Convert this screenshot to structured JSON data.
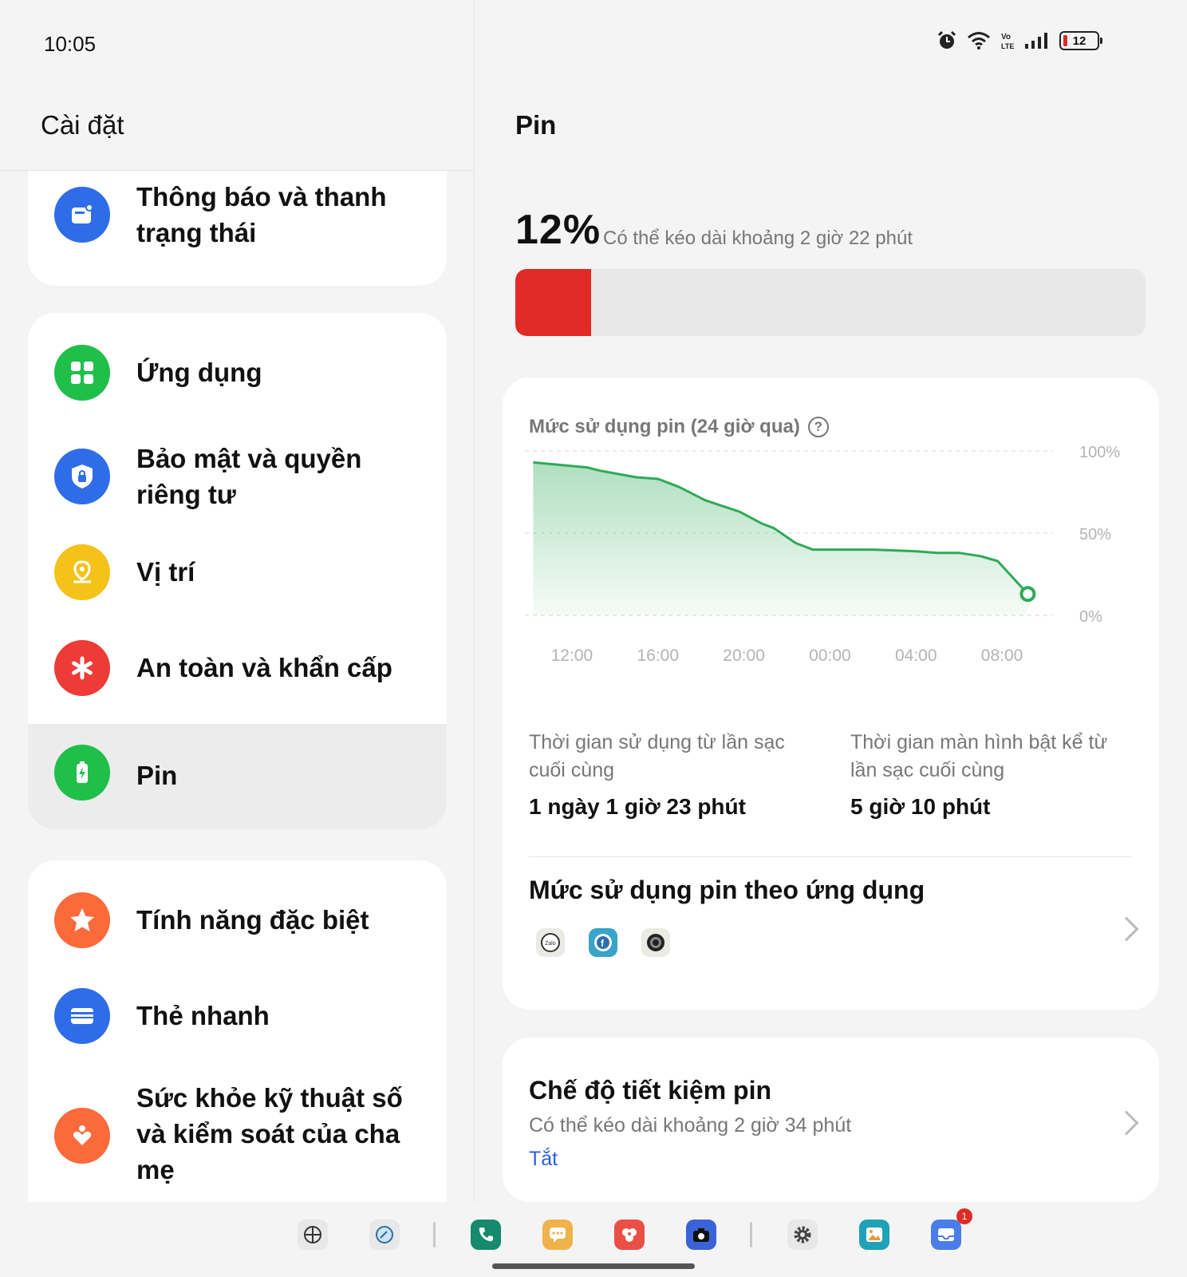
{
  "status_bar": {
    "time": "10:05",
    "icons": [
      "alarm-icon",
      "wifi-icon",
      "volte-icon",
      "signal-icon"
    ],
    "volte_text": "Vo\nLTE",
    "battery_level": "12"
  },
  "left": {
    "title": "Cài đặt",
    "items": [
      {
        "label": "Thông báo và thanh trạng thái",
        "icon": "notification-icon",
        "color": "#2f6de8"
      },
      {
        "label": "Ứng dụng",
        "icon": "apps-grid-icon",
        "color": "#1fbf4a"
      },
      {
        "label": "Bảo mật và quyền riêng tư",
        "icon": "shield-lock-icon",
        "color": "#2f6de8"
      },
      {
        "label": "Vị trí",
        "icon": "location-pin-icon",
        "color": "#f5c21a"
      },
      {
        "label": "An toàn và khẩn cấp",
        "icon": "asterisk-icon",
        "color": "#ee3b35"
      },
      {
        "label": "Pin",
        "icon": "battery-icon",
        "color": "#1fbf4a",
        "selected": true
      },
      {
        "label": "Tính năng đặc biệt",
        "icon": "star-icon",
        "color": "#fb6a3a"
      },
      {
        "label": "Thẻ nhanh",
        "icon": "cards-icon",
        "color": "#2f6de8"
      },
      {
        "label": "Sức khỏe kỹ thuật số và kiểm soát của cha mẹ",
        "icon": "heart-person-icon",
        "color": "#fb6a3a"
      }
    ]
  },
  "right": {
    "title": "Pin",
    "battery_percent": "12%",
    "battery_fraction": 0.12,
    "estimate": "Có thể kéo dài khoảng 2 giờ 22 phút",
    "bar_color": "#e02a25",
    "usage_card": {
      "title": "Mức sử dụng pin (24 giờ qua)",
      "help": "?",
      "stat1_label": "Thời gian sử dụng từ lần sạc cuối cùng",
      "stat1_value": "1 ngày 1 giờ 23 phút",
      "stat2_label": "Thời gian màn hình bật kể từ lần sạc cuối cùng",
      "stat2_value": "5 giờ 10 phút",
      "by_app_title": "Mức sử dụng pin theo ứng dụng",
      "app_icons": [
        "zalo-icon",
        "facebook-icon",
        "galaxy-app-icon"
      ]
    },
    "saver_card": {
      "title": "Chế độ tiết kiệm pin",
      "estimate": "Có thể kéo dài khoảng 2 giờ 34 phút",
      "state": "Tắt"
    }
  },
  "chart_data": {
    "type": "area",
    "title": "Mức sử dụng pin (24 giờ qua)",
    "x_tick_labels": [
      "12:00",
      "16:00",
      "20:00",
      "00:00",
      "04:00",
      "08:00"
    ],
    "y_tick_labels": [
      "100%",
      "50%",
      "0%"
    ],
    "ylim": [
      0,
      100
    ],
    "xlim": [
      10,
      34
    ],
    "x": [
      10.2,
      12.7,
      13.3,
      15.0,
      16.0,
      17.0,
      18.2,
      19.8,
      20.8,
      21.4,
      22.4,
      23.2,
      25.0,
      26.0,
      28.0,
      29.0,
      30.0,
      31.0,
      31.8,
      33.2
    ],
    "y": [
      93,
      90,
      88,
      84,
      83,
      78,
      70,
      63,
      56,
      53,
      44,
      40,
      40,
      40,
      39,
      38,
      38,
      36,
      33,
      13
    ],
    "color": "#2eaa57",
    "grid": true
  },
  "dock": {
    "icons": [
      {
        "name": "grid-app-icon",
        "color": "#e8e8e8"
      },
      {
        "name": "browser-icon",
        "color": "#e8e8e8"
      },
      {
        "name": "phone-icon",
        "color": "#158a6c"
      },
      {
        "name": "messages-icon",
        "color": "#f0b24a"
      },
      {
        "name": "flower-app-icon",
        "color": "#ea4f45"
      },
      {
        "name": "camera-icon",
        "color": "#3b63d8"
      },
      {
        "name": "settings-icon",
        "color": "#e8e8e8"
      },
      {
        "name": "gallery-icon",
        "color": "#1fa2b8"
      },
      {
        "name": "inbox-icon",
        "color": "#4a7de8"
      }
    ],
    "badge": "1"
  }
}
